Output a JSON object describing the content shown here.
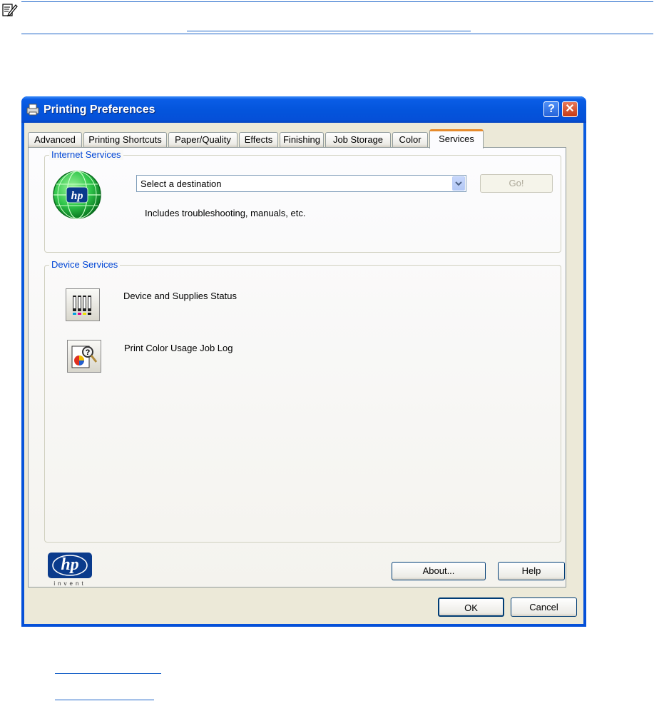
{
  "window": {
    "title": "Printing Preferences",
    "help_glyph": "?",
    "close_glyph": "✕"
  },
  "tabs": [
    {
      "label": "Advanced"
    },
    {
      "label": "Printing Shortcuts"
    },
    {
      "label": "Paper/Quality"
    },
    {
      "label": "Effects"
    },
    {
      "label": "Finishing"
    },
    {
      "label": "Job Storage"
    },
    {
      "label": "Color"
    },
    {
      "label": "Services",
      "active": true
    }
  ],
  "internet_services": {
    "group_label": "Internet Services",
    "destination_value": "Select a destination",
    "go_label": "Go!",
    "description": "Includes troubleshooting, manuals, etc."
  },
  "device_services": {
    "group_label": "Device Services",
    "items": [
      {
        "label": "Device and Supplies Status",
        "icon": "supplies-status-icon"
      },
      {
        "label": "Print Color Usage Job Log",
        "icon": "color-usage-log-icon"
      }
    ]
  },
  "branding": {
    "logo_text": "hp",
    "tagline": "invent"
  },
  "footer_buttons": {
    "about": "About...",
    "help": "Help",
    "ok": "OK",
    "cancel": "Cancel"
  },
  "colors": {
    "titlebar": "#0550d8",
    "group_label": "#0046d5",
    "active_tab_accent": "#e68b2c",
    "hp_blue": "#0a3b8c",
    "link_line": "#1a63c8"
  }
}
